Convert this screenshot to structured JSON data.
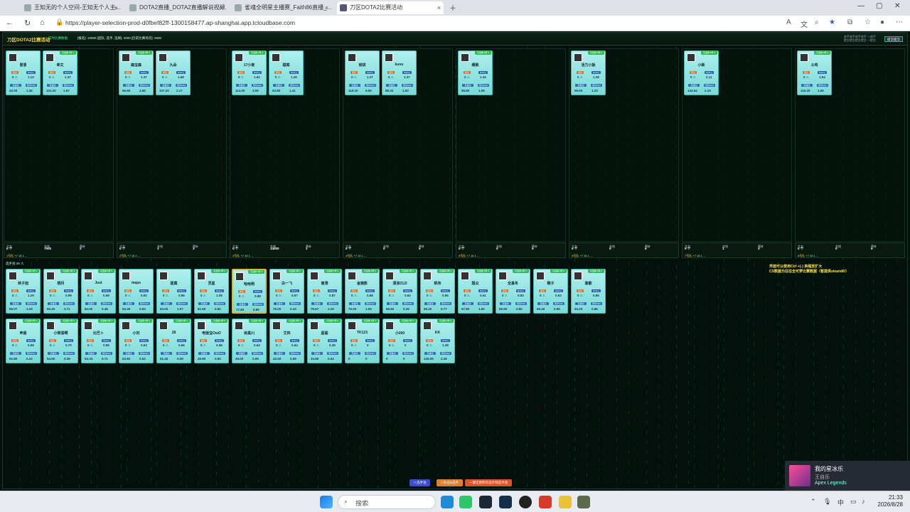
{
  "browser": {
    "tabs": [
      {
        "label": "王知无的个人空间-王知无个人主..."
      },
      {
        "label": "DOTA2直播_DOTA2直播解说视频..."
      },
      {
        "label": "雀魂全明星主播赛_Faith86直播_..."
      },
      {
        "label": "刀区DOTA2比赛活动"
      }
    ],
    "url": "https://player-selection-prod-d0fbef82ff-1300158477.ap-shanghai.app.tcloudbase.com"
  },
  "header": {
    "title": "刀区DOTA2比赛活动",
    "subtitle": "实时比赛数据",
    "stats": "[报名]: 10000  [团队, 选手, 选择]: 2000  [历史比赛场次]: 2000",
    "right_line1": "选手选手选手选手 ↑↑选手",
    "right_line2": "提交提交提交提交 ↑↑提交",
    "right_button": "提交提交"
  },
  "labels": {
    "rank": "段位",
    "rating": "Rating",
    "hero_pool": "英雄池",
    "kda": "场均KDA"
  },
  "teams": [
    {
      "foot": {
        "s1": "主力",
        "b1": "0 个",
        "s2": "金钱",
        "b2": "7000",
        "s3": "替补",
        "b3": "2",
        "f": "1号队",
        "g": "+7 18 1 ..."
      },
      "players": [
        {
          "name": "冒冒",
          "badge": "",
          "rank": "0 ⚠",
          "rating": "1.13",
          "pool": "42.00",
          "kda": "1.36"
        },
        {
          "name": "奉文",
          "badge": "可选择 8号 4",
          "rank": "0 ⚠",
          "rating": "1.47",
          "pool": "101.20",
          "kda": "1.67"
        }
      ]
    },
    {
      "foot": {
        "s1": "主力",
        "b1": "0 个",
        "s2": "金钱",
        "b2": "1",
        "s3": "替补",
        "b3": "3",
        "f": "2号队",
        "g": "+7 16 1 ..."
      },
      "players": [
        {
          "name": "森宝森",
          "badge": "可选择 8号 5",
          "rank": "0 ⚠",
          "rating": "1.37",
          "pool": "66.60",
          "kda": "2.58"
        },
        {
          "name": "九朵",
          "badge": "",
          "rank": "0 ⚠",
          "rating": "1.68",
          "pool": "107.20",
          "kda": "2.17"
        }
      ]
    },
    {
      "foot": {
        "s1": "主力",
        "b1": "0 个",
        "s2": "金钱",
        "b2": "14000",
        "s3": "替补",
        "b3": "1",
        "f": "3号队",
        "g": "+7 16 1 ..."
      },
      "players": [
        {
          "name": "17小夜",
          "badge": "可选择 8号 2",
          "rank": "0 ⚠",
          "rating": "1.62",
          "pool": "114.00",
          "kda": "3.00"
        },
        {
          "name": "甜菜",
          "badge": "",
          "rank": "0 ⚠",
          "rating": "1.26",
          "pool": "53.80",
          "kda": "1.41"
        }
      ]
    },
    {
      "foot": {
        "s1": "主力",
        "b1": "0 个",
        "s2": "金钱",
        "b2": "0",
        "s3": "替补",
        "b3": "5",
        "f": "4号队",
        "g": "+7 16 1 ..."
      },
      "players": [
        {
          "name": "钱饼",
          "badge": "",
          "rank": "0 ⚠",
          "rating": "1.37",
          "pool": "119.20",
          "kda": "6.80"
        },
        {
          "name": "kuno",
          "badge": "",
          "rank": "0 ⚠",
          "rating": "1.37",
          "pool": "88.33",
          "kda": "1.00"
        }
      ]
    },
    {
      "foot": {
        "s1": "主力",
        "b1": "0 个",
        "s2": "金钱",
        "b2": "0",
        "s3": "替补",
        "b3": "5",
        "f": "5号队",
        "g": "+7 16 1 ..."
      },
      "players": [
        {
          "name": "缠枫",
          "badge": "可选择 8号 5",
          "rank": "0 ⚠",
          "rating": "1.34",
          "pool": "56.80",
          "kda": "1.05"
        }
      ]
    },
    {
      "foot": {
        "s1": "主力",
        "b1": "0 个",
        "s2": "金钱",
        "b2": "0",
        "s3": "替补",
        "b3": "5",
        "f": "6号队",
        "g": "+7 16 1 ..."
      },
      "players": [
        {
          "name": "活力小扳",
          "badge": "可选择 8号 5",
          "rank": "0 ⚠",
          "rating": "1.38",
          "pool": "59.00",
          "kda": "1.33"
        }
      ]
    },
    {
      "foot": {
        "s1": "主力",
        "b1": "0 个",
        "s2": "金钱",
        "b2": "1",
        "s3": "替补",
        "b3": "3",
        "f": "7号队",
        "g": "+7 16 1 ..."
      },
      "players": [
        {
          "name": "小新",
          "badge": "可选择 8号 5",
          "rank": "0 ⚠",
          "rating": "2.11",
          "pool": "143.54",
          "kda": "2.15"
        }
      ]
    },
    {
      "foot": {
        "s1": "主力",
        "b1": "0 个",
        "s2": "金钱",
        "b2": "0",
        "s3": "替补",
        "b3": "5",
        "f": "8号队",
        "g": "+7 16 1 ..."
      },
      "players": [
        {
          "name": "斗鸡",
          "badge": "可选择 8号 5",
          "rank": "0 ⚠",
          "rating": "1.64",
          "pool": "115.29",
          "kda": "1.65"
        }
      ]
    }
  ],
  "pool": {
    "header": "选手池 28 人",
    "tip_line1": "界面可以使用Ctrl +(-) 来缩放扩大",
    "tip_line2": "CS数据为往往全可梦比赛数据（暂提供steam80）",
    "players": [
      {
        "name": "林子旭",
        "badge": "可选择 8号 5",
        "rank": "0 ⚠",
        "rating": "1.29",
        "pool": "59.07",
        "kda": "1.29"
      },
      {
        "name": "栖月",
        "badge": "可选择 8号 5",
        "rank": "0 ⚠",
        "rating": "0.99",
        "pool": "95.20",
        "kda": "2.71"
      },
      {
        "name": "Just",
        "badge": "可选择 8号 5",
        "rank": "0 ⚠",
        "rating": "0.59",
        "pool": "84.00",
        "kda": "0.48"
      },
      {
        "name": "maps",
        "badge": "",
        "rank": "0 ⚠",
        "rating": "0.92",
        "pool": "53.40",
        "kda": "0.83"
      },
      {
        "name": "提莫",
        "badge": "",
        "rank": "0 ⚠",
        "rating": "0.86",
        "pool": "53.00",
        "kda": "1.07"
      },
      {
        "name": "灵星",
        "badge": "可选择 8号 5",
        "rank": "0 ⚠",
        "rating": "1.08",
        "pool": "81.60",
        "kda": "0.82"
      },
      {
        "name": "哈哈明",
        "badge": "可选择 8号 5",
        "rank": "0 ⚠",
        "rating": "0.88",
        "pool": "77.60",
        "kda": "0.80",
        "hl": true
      },
      {
        "name": "白一飞",
        "badge": "可选择 8号 5",
        "rank": "0 ⚠",
        "rating": "0.97",
        "pool": "76.00",
        "kda": "0.33"
      },
      {
        "name": "南澄",
        "badge": "可选择 8号 5",
        "rank": "0 ⚠",
        "rating": "0.87",
        "pool": "75.67",
        "kda": "1.29"
      },
      {
        "name": "金猪影",
        "badge": "可选择 8号 5",
        "rank": "0 ⚠",
        "rating": "0.68",
        "pool": "75.00",
        "kda": "1.05"
      },
      {
        "name": "清涼Z1Zl",
        "badge": "可选择 8号 5",
        "rank": "0 ⚠",
        "rating": "0.64",
        "pool": "69.60",
        "kda": "0.25"
      },
      {
        "name": "帆布",
        "badge": "可选择 8号 5",
        "rank": "0 ⚠",
        "rating": "0.85",
        "pool": "69.20",
        "kda": "0.77"
      },
      {
        "name": "阻瓜",
        "badge": "可选择 8号 5",
        "rank": "0 ⚠",
        "rating": "0.61",
        "pool": "67.80",
        "kda": "1.50"
      },
      {
        "name": "全基冬",
        "badge": "可选择 8号 5",
        "rank": "0 ⚠",
        "rating": "0.83",
        "pool": "65.60",
        "kda": "0.80"
      },
      {
        "name": "鞣子",
        "badge": "可选择 8号 5",
        "rank": "0 ⚠",
        "rating": "0.63",
        "pool": "65.40",
        "kda": "0.65"
      },
      {
        "name": "漱歌",
        "badge": "可选择 8号 5",
        "rank": "0 ⚠",
        "rating": "0.86",
        "pool": "63.20",
        "kda": "0.86"
      },
      {
        "name": "申屋",
        "badge": "可选择 8号 5",
        "rank": "0 ⚠",
        "rating": "0.69",
        "pool": "62.80",
        "kda": "0.22"
      },
      {
        "name": "小笨蛋啊",
        "badge": "可选择 8号 5",
        "rank": "0 ⚠",
        "rating": "0.70",
        "pool": "54.50",
        "kda": "0.35"
      },
      {
        "name": "比巴卜",
        "badge": "可选择 8号 5",
        "rank": "0 ⚠",
        "rating": "0.85",
        "pool": "53.33",
        "kda": "0.71"
      },
      {
        "name": "小刘",
        "badge": "可选择 8号 5",
        "rank": "0 ⚠",
        "rating": "0.63",
        "pool": "53.60",
        "kda": "0.54"
      },
      {
        "name": "28",
        "badge": "可选择 8号 5",
        "rank": "0 ⚠",
        "rating": "0.66",
        "pool": "51.40",
        "kda": "0.59"
      },
      {
        "name": "电饭宝OwO",
        "badge": "可选择 8号 5",
        "rank": "0 ⚠",
        "rating": "0.68",
        "pool": "49.80",
        "kda": "0.50"
      },
      {
        "name": "目黑川",
        "badge": "可选择 8号 5",
        "rank": "0 ⚠",
        "rating": "0.63",
        "pool": "49.00",
        "kda": "0.09"
      },
      {
        "name": "艾帅",
        "badge": "可选择 8号 5",
        "rank": "0 ⚠",
        "rating": "0.64",
        "pool": "42.50",
        "kda": "0.59"
      },
      {
        "name": "星聪",
        "badge": "可选择 8号 5",
        "rank": "0 ⚠",
        "rating": "0.39",
        "pool": "33.80",
        "kda": "0.54"
      },
      {
        "name": "TK123",
        "badge": "可选择 8号 5",
        "rank": "0 ⚠",
        "rating": "0",
        "pool": "0",
        "kda": "0"
      },
      {
        "name": "小000",
        "badge": "可选择 8号 5",
        "rank": "0 ⚠",
        "rating": "0",
        "pool": "0",
        "kda": "0"
      },
      {
        "name": "KK",
        "badge": "可选择 8号 5",
        "rank": "0 ⚠",
        "rating": "1.38",
        "pool": "126.06",
        "kda": "2.35"
      }
    ]
  },
  "bottom_buttons": [
    {
      "label": "□ 选手池",
      "color": "#3a4fd0"
    },
    {
      "label": "□ 队伍&选手",
      "color": "#e0802a"
    },
    {
      "label": "一键还原所有选手到选手池",
      "color": "#e0522a"
    }
  ],
  "notification": {
    "title": "我的星冰乐",
    "subtitle": "王自乐",
    "app": "Apex Legends"
  },
  "taskbar": {
    "search_placeholder": "搜索",
    "ime": "中",
    "time": "21:33",
    "date": "2026/8/28"
  }
}
